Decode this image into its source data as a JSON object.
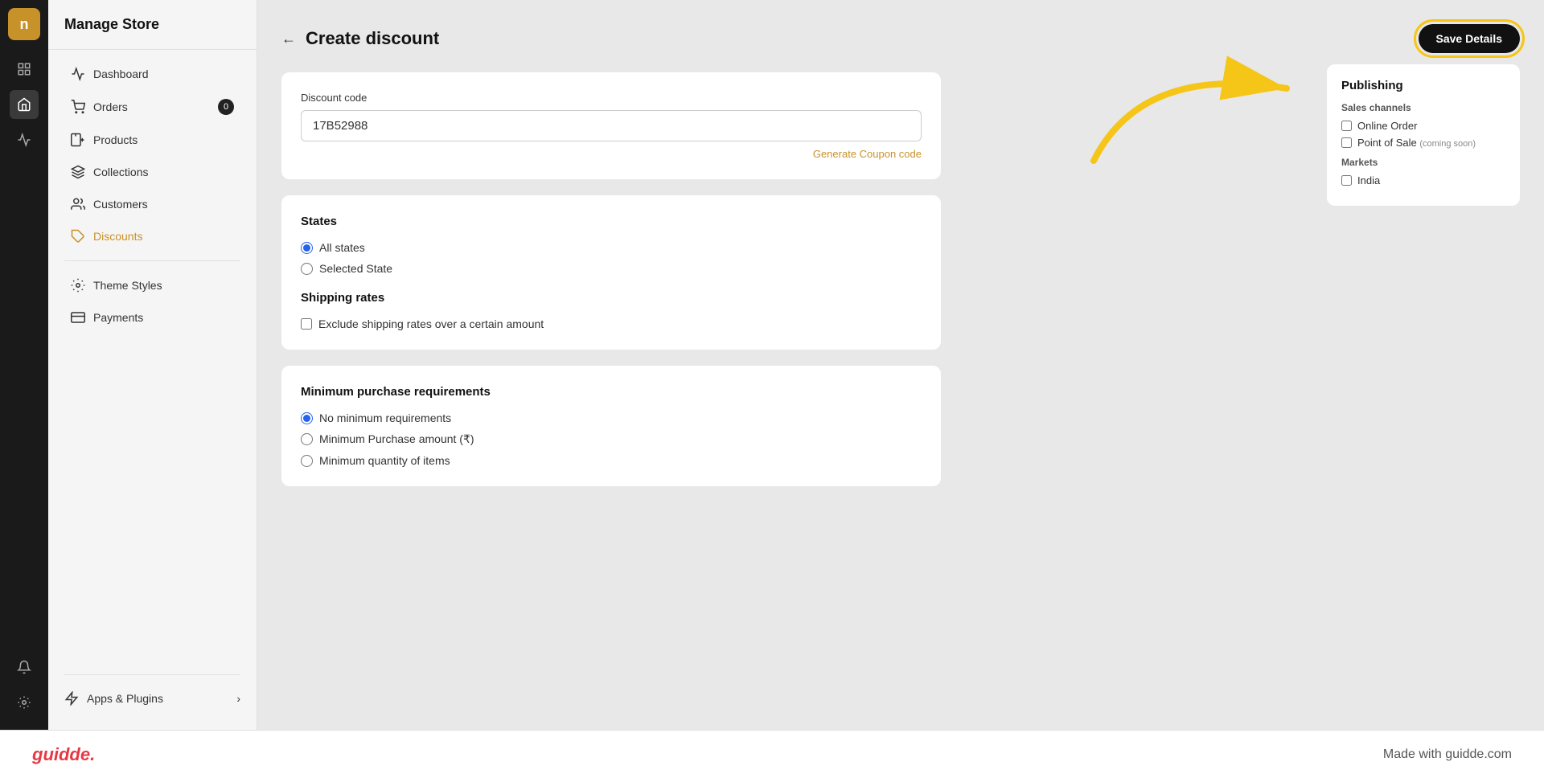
{
  "app": {
    "logo_letter": "n",
    "store_title": "Manage Store"
  },
  "sidebar": {
    "nav_items": [
      {
        "id": "dashboard",
        "label": "Dashboard",
        "icon": "chart-icon",
        "badge": null,
        "active": false
      },
      {
        "id": "orders",
        "label": "Orders",
        "icon": "orders-icon",
        "badge": "0",
        "active": false
      },
      {
        "id": "products",
        "label": "Products",
        "icon": "products-icon",
        "badge": null,
        "active": false
      },
      {
        "id": "collections",
        "label": "Collections",
        "icon": "collections-icon",
        "badge": null,
        "active": false
      },
      {
        "id": "customers",
        "label": "Customers",
        "icon": "customers-icon",
        "badge": null,
        "active": false
      },
      {
        "id": "discounts",
        "label": "Discounts",
        "icon": "discounts-icon",
        "badge": null,
        "active": true
      }
    ],
    "divider_items": [
      {
        "id": "theme-styles",
        "label": "Theme Styles",
        "icon": "theme-icon",
        "active": false
      },
      {
        "id": "payments",
        "label": "Payments",
        "icon": "payments-icon",
        "active": false
      }
    ],
    "apps_label": "Apps & Plugins"
  },
  "page": {
    "back_label": "←",
    "title": "Create discount",
    "save_button_label": "Save Details"
  },
  "discount_code_section": {
    "label": "Discount code",
    "value": "17B52988",
    "generate_link": "Generate Coupon code"
  },
  "states_section": {
    "title": "States",
    "options": [
      {
        "id": "all-states",
        "label": "All states",
        "checked": true
      },
      {
        "id": "selected-state",
        "label": "Selected State",
        "checked": false
      }
    ]
  },
  "shipping_section": {
    "title": "Shipping rates",
    "checkbox_label": "Exclude shipping rates over a certain amount",
    "checked": false
  },
  "min_purchase_section": {
    "title": "Minimum purchase requirements",
    "options": [
      {
        "id": "no-min",
        "label": "No minimum requirements",
        "checked": true
      },
      {
        "id": "min-amount",
        "label": "Minimum Purchase amount (₹)",
        "checked": false
      },
      {
        "id": "min-qty",
        "label": "Minimum quantity of items",
        "checked": false
      }
    ]
  },
  "publishing": {
    "title": "Publishing",
    "sales_channels_label": "Sales channels",
    "channels": [
      {
        "id": "online-order",
        "label": "Online Order",
        "checked": false
      },
      {
        "id": "pos",
        "label": "Point of Sale (coming soon)",
        "checked": false
      }
    ],
    "markets_label": "Markets",
    "markets": [
      {
        "id": "india",
        "label": "India",
        "checked": false
      }
    ]
  },
  "footer": {
    "logo": "guidde.",
    "credit": "Made with guidde.com"
  }
}
